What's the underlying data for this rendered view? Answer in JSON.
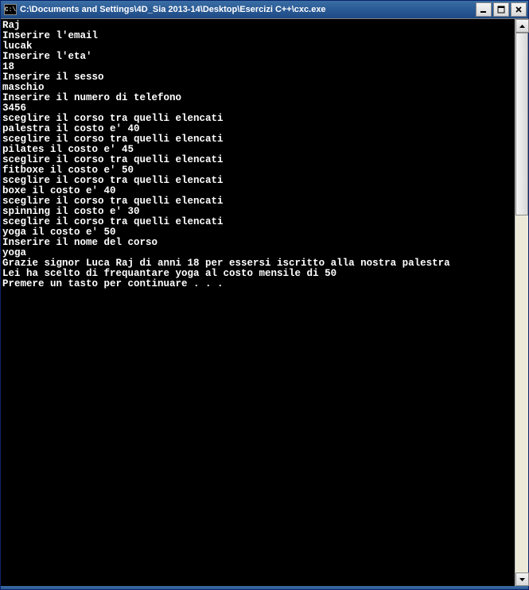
{
  "window": {
    "icon_text": "C:\\",
    "title": "C:\\Documents and Settings\\4D_Sia 2013-14\\Desktop\\Esercizi C++\\cxc.exe"
  },
  "console_lines": [
    "Raj",
    "Inserire l'email",
    "lucak",
    "Inserire l'eta'",
    "18",
    "Inserire il sesso",
    "maschio",
    "Inserire il numero di telefono",
    "3456",
    "sceglire il corso tra quelli elencati",
    "palestra il costo e' 40",
    "sceglire il corso tra quelli elencati",
    "pilates il costo e' 45",
    "sceglire il corso tra quelli elencati",
    "fitboxe il costo e' 50",
    "sceglire il corso tra quelli elencati",
    "boxe il costo e' 40",
    "sceglire il corso tra quelli elencati",
    "spinning il costo e' 30",
    "sceglire il corso tra quelli elencati",
    "yoga il costo e' 50",
    "Inserire il nome del corso",
    "yoga",
    "Grazie signor Luca Raj di anni 18 per essersi iscritto alla nostra palestra",
    "Lei ha scelto di frequantare yoga al costo mensile di 50",
    "Premere un tasto per continuare . . ."
  ]
}
